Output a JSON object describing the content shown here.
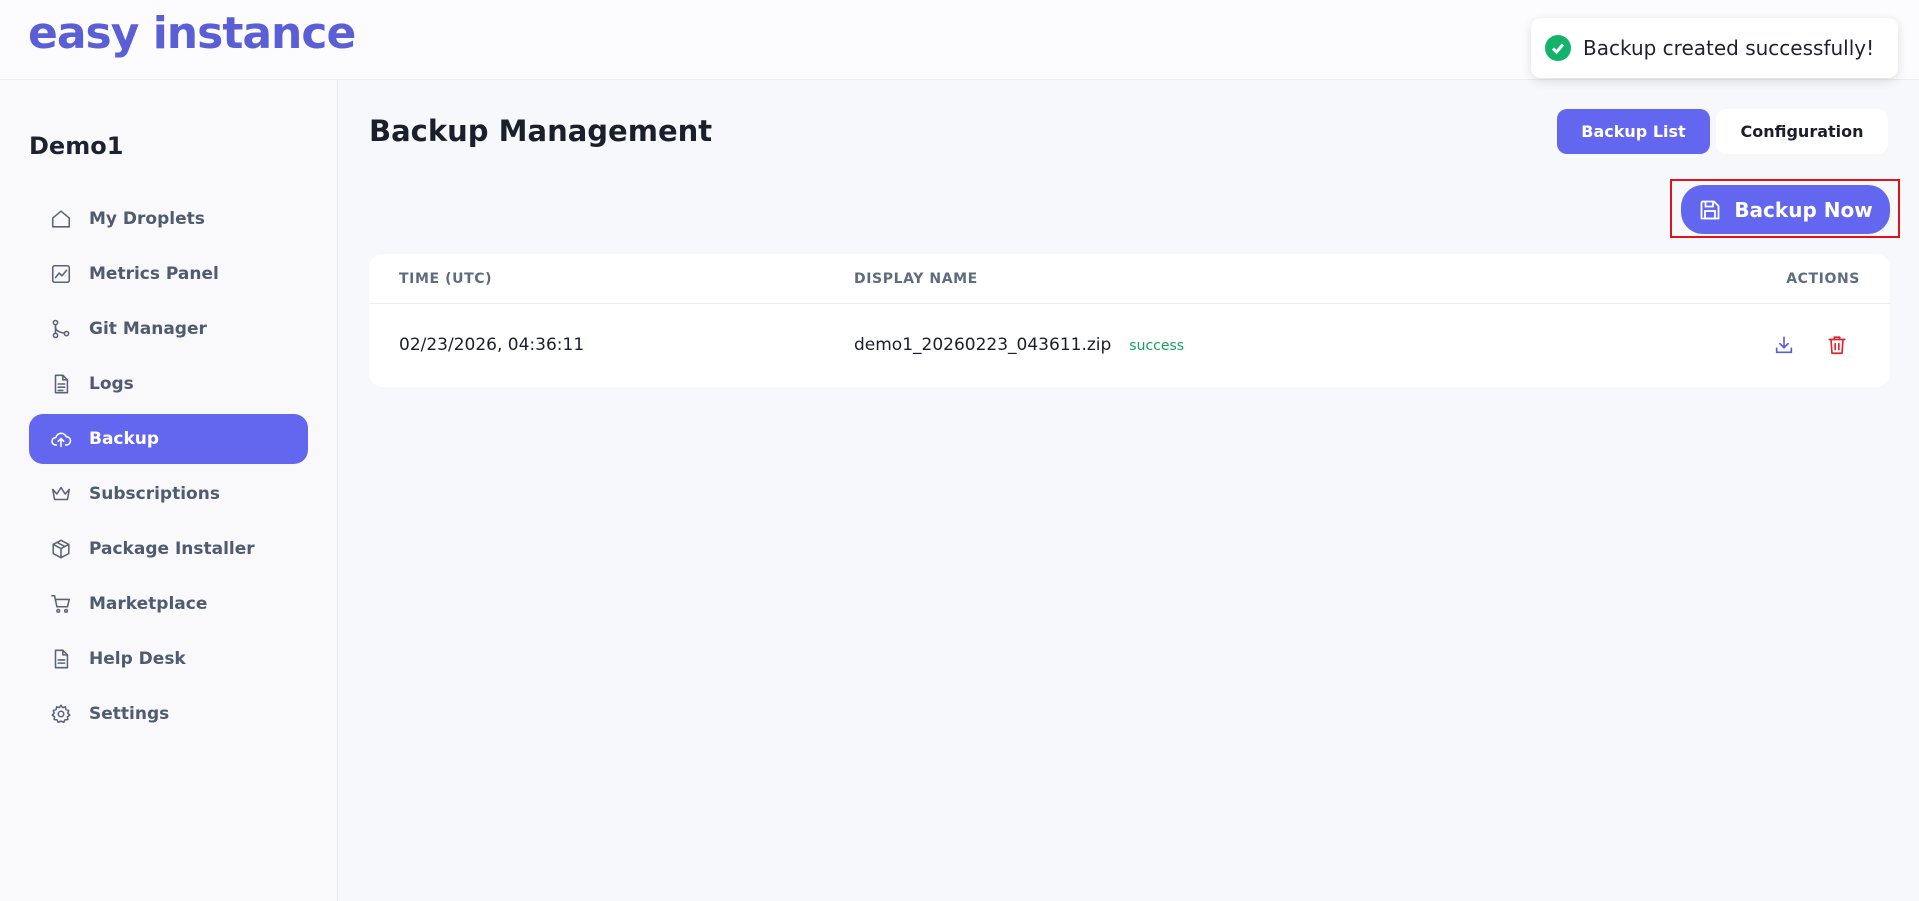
{
  "app": {
    "logo_text": "easy instance"
  },
  "toast": {
    "message": "Backup created successfully!",
    "icon": "check-circle-icon",
    "color": "#14b36b"
  },
  "sidebar": {
    "project_name": "Demo1",
    "items": [
      {
        "label": "My Droplets",
        "icon": "home-icon",
        "active": false
      },
      {
        "label": "Metrics Panel",
        "icon": "chart-icon",
        "active": false
      },
      {
        "label": "Git Manager",
        "icon": "git-branch-icon",
        "active": false
      },
      {
        "label": "Logs",
        "icon": "document-icon",
        "active": false
      },
      {
        "label": "Backup",
        "icon": "cloud-upload-icon",
        "active": true
      },
      {
        "label": "Subscriptions",
        "icon": "crown-icon",
        "active": false
      },
      {
        "label": "Package Installer",
        "icon": "package-icon",
        "active": false
      },
      {
        "label": "Marketplace",
        "icon": "cart-icon",
        "active": false
      },
      {
        "label": "Help Desk",
        "icon": "file-icon",
        "active": false
      },
      {
        "label": "Settings",
        "icon": "gear-icon",
        "active": false
      }
    ]
  },
  "main": {
    "title": "Backup Management",
    "tabs": [
      {
        "label": "Backup List",
        "active": true
      },
      {
        "label": "Configuration",
        "active": false
      }
    ],
    "backup_now_label": "Backup Now",
    "table": {
      "headers": {
        "time": "TIME (UTC)",
        "name": "DISPLAY NAME",
        "actions": "ACTIONS"
      },
      "rows": [
        {
          "time": "02/23/2026, 04:36:11",
          "name": "demo1_20260223_043611.zip",
          "status": "success"
        }
      ]
    }
  },
  "colors": {
    "accent": "#6366ef",
    "brand": "#5a5fd6",
    "success": "#18a05e",
    "danger": "#e0242b",
    "highlight": "#e0121a"
  }
}
